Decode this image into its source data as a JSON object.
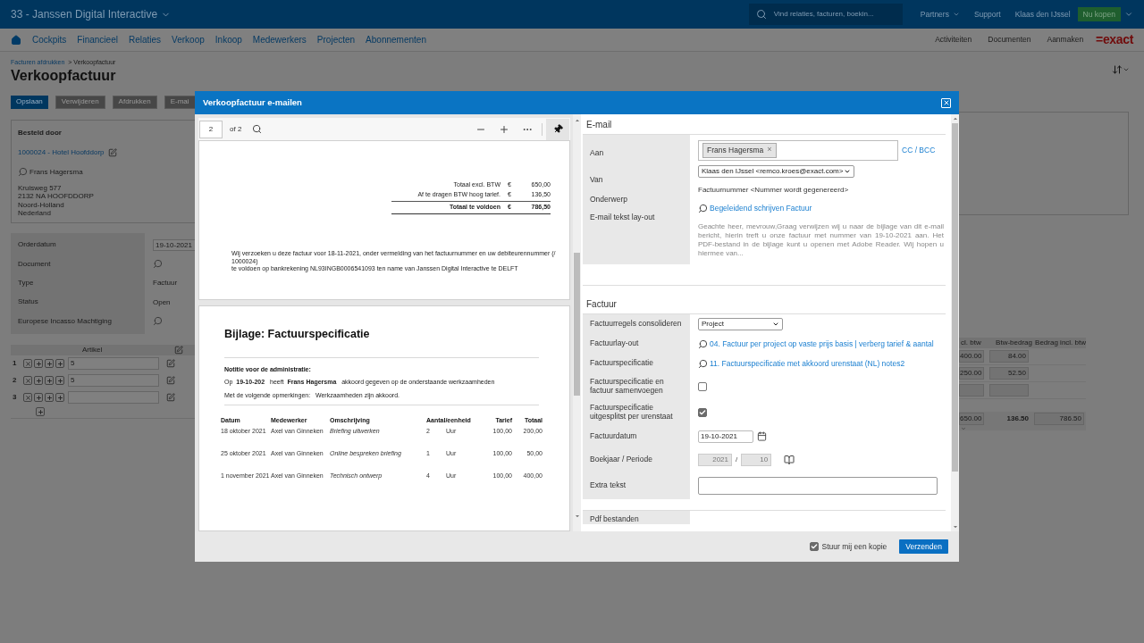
{
  "app": {
    "company": "33 - Janssen Digital Interactive",
    "search": {
      "placeholder": "Vind relaties, facturen, boekin..."
    },
    "top_links": [
      "Partners",
      "Support"
    ],
    "user": "Klaas den IJssel",
    "buy_button": "Nu kopen"
  },
  "nav": {
    "items": [
      "Cockpits",
      "Financieel",
      "Relaties",
      "Verkoop",
      "Inkoop",
      "Medewerkers",
      "Projecten",
      "Abonnementen"
    ],
    "right_items": [
      "Activiteiten",
      "Documenten",
      "Aanmaken"
    ],
    "logo": "=exact"
  },
  "breadcrumb": {
    "link": "Facturen afdrukken",
    "current": "> Verkoopfactuur"
  },
  "page_title": "Verkoopfactuur",
  "actions": [
    {
      "label": "Opslaan",
      "primary": true
    },
    {
      "label": "Verwijderen",
      "primary": false
    },
    {
      "label": "Afdrukken",
      "primary": false
    },
    {
      "label": "E-mai",
      "primary": false
    }
  ],
  "ordered_by": {
    "title": "Besteld door",
    "account": "1000024 - Hotel Hoofddorp",
    "contact": "Frans Hagersma",
    "address": [
      "Kruisweg 577",
      "2132 NA HOOFDDORP",
      "Noord-Holland",
      "Nederland"
    ]
  },
  "fields": [
    {
      "label": "Orderdatum",
      "kind": "input",
      "value": "19-10-2021"
    },
    {
      "label": "Document",
      "kind": "lookup"
    },
    {
      "label": "Type",
      "kind": "text",
      "value": "Factuur"
    },
    {
      "label": "Status",
      "kind": "text",
      "value": "Open"
    },
    {
      "label": "Europese Incasso Machtiging",
      "kind": "lookup"
    }
  ],
  "lines": {
    "column": "Artikel",
    "rows": [
      {
        "number": "1",
        "article": "5"
      },
      {
        "number": "2",
        "article": "5"
      },
      {
        "number": "3"
      }
    ]
  },
  "amounts": {
    "columns": [
      "cl. btw",
      "Btw-bedrag",
      "Bedrag incl. btw"
    ],
    "rows": [
      {
        "kind": "values",
        "excl": "400.00",
        "vat": "84.00"
      },
      {
        "kind": "values",
        "excl": "250.00",
        "vat": "52.50"
      },
      {
        "kind": "blank"
      }
    ],
    "total": {
      "excl": "650.00",
      "vat": "136.50",
      "incl": "786.50"
    }
  },
  "dialog": {
    "title": "Verkoopfactuur e-mailen",
    "pdf": {
      "page": "2",
      "page_count": "of 2",
      "totals": [
        {
          "label": "Totaal excl. BTW",
          "currency": "€",
          "amount": "650,00",
          "bold": false
        },
        {
          "label": "Af te dragen BTW hoog tarief.",
          "currency": "€",
          "amount": "136,50",
          "bold": false
        },
        {
          "label": "Totaal te voldoen",
          "currency": "€",
          "amount": "786,50",
          "bold": true
        }
      ],
      "payment": [
        "Wij verzoeken u deze factuur voor  18-11-2021, onder vermelding van het factuurnummer en uw debiteurennummer (/ 1000024)",
        "te voldoen op bankrekening NL93INGB0006541093 ten name van Janssen Digital Interactive te DELFT"
      ],
      "spec_title": "Bijlage: Factuurspecificatie",
      "note_title": "Notitie voor de administratie:",
      "approval": "Op  **19-10-202**   heeft  **Frans Hagersma**   akkoord gegeven op de onderstaande werkzaamheden",
      "remarks": "Met de volgende opmerkingen:   Werkzaamheden zijn akkoord.",
      "columns": [
        "Datum",
        "Medewerker",
        "Omschrijving",
        "Aantal/eenheid",
        "Tarief",
        "Totaal"
      ],
      "rows": [
        {
          "date": "18 oktober 2021",
          "employee": "Axel van Ginneken",
          "description": "Briefing uitwerken",
          "qty": "2",
          "unit": "Uur",
          "rate": "100,00",
          "total": "200,00"
        },
        {
          "date": "25 oktober 2021",
          "employee": "Axel van Ginneken",
          "description": "Online bespreken briefing",
          "qty": "1",
          "unit": "Uur",
          "rate": "100,00",
          "total": "50,00"
        },
        {
          "date": "1 november 2021",
          "employee": "Axel van Ginneken",
          "description": "Technisch ontwerp",
          "qty": "4",
          "unit": "Uur",
          "rate": "100,00",
          "total": "400,00"
        }
      ]
    },
    "email": {
      "section": "E-mail",
      "to_label": "Aan",
      "recipient": "Frans Hagersma",
      "remove": "×",
      "cc": "CC / BCC",
      "from_label": "Van",
      "from": "Klaas den IJssel <remco.kroes@exact.com>",
      "subject_label": "Onderwerp",
      "subject": "Factuurnummer <Nummer wordt gegenereerd>",
      "layout_label": "E-mail tekst lay-out",
      "layout": "Begeleidend schrijven Factuur",
      "preview": "Geachte heer, mevrouw,Graag verwijzen wij u naar de bijlage van dit e-mail bericht, hierin treft u onze factuur met nummer  van 19-10-2021 aan. Het PDF-bestand in de bijlage kunt u openen met Adobe Reader. Wij hopen u hiermee van..."
    },
    "invoice": {
      "section": "Factuur",
      "rows": [
        {
          "label": "Factuurregels consolideren",
          "kind": "select",
          "value": "Project"
        },
        {
          "label": "Factuurlay-out",
          "kind": "link",
          "value": "04. Factuur per project op vaste prijs basis | verberg tarief & aantal"
        },
        {
          "label": "Factuurspecificatie",
          "kind": "link",
          "value": "11. Factuurspecificatie met akkoord urenstaat (NL) notes2"
        },
        {
          "label": "Factuurspecificatie en factuur samenvoegen",
          "kind": "checkbox",
          "checked": false
        },
        {
          "label": "Factuurspecificatie uitgesplitst per urenstaat",
          "kind": "checkbox",
          "checked": true
        },
        {
          "label": "Factuurdatum",
          "kind": "date",
          "value": "19-10-2021"
        },
        {
          "label": "Boekjaar / Periode",
          "kind": "period",
          "year": "2021",
          "separator": "/",
          "period": "10"
        },
        {
          "label": "Extra tekst",
          "kind": "textarea"
        }
      ],
      "next_section": "Pdf bestanden"
    },
    "footer": {
      "copy_label": "Stuur mij een kopie",
      "copy_checked": true,
      "send": "Verzenden"
    }
  }
}
